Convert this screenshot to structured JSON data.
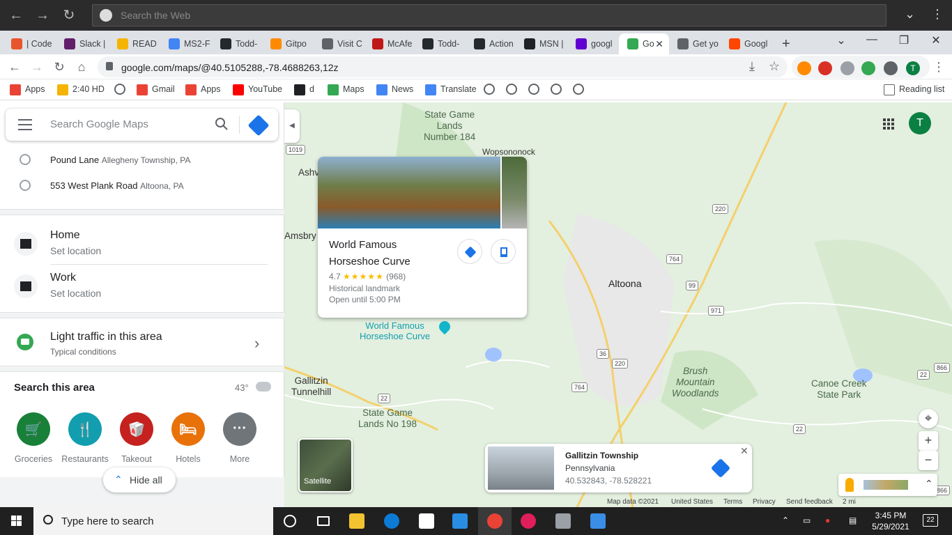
{
  "os_bar": {
    "search_placeholder": "Search the Web"
  },
  "tabs": [
    {
      "label": "| Code",
      "color": "#e8552d"
    },
    {
      "label": "Slack |",
      "color": "#611f69"
    },
    {
      "label": "READ",
      "color": "#f4b400"
    },
    {
      "label": "MS2-F",
      "color": "#4285f4"
    },
    {
      "label": "Todd-",
      "color": "#24292e"
    },
    {
      "label": "Gitpo",
      "color": "#ff8a00"
    },
    {
      "label": "Visit C",
      "color": "#5f6368"
    },
    {
      "label": "McAfe",
      "color": "#c01818"
    },
    {
      "label": "Todd-",
      "color": "#24292e"
    },
    {
      "label": "Action",
      "color": "#24292e"
    },
    {
      "label": "MSN |",
      "color": "#202124"
    },
    {
      "label": "googl",
      "color": "#6001d2"
    },
    {
      "label": "Go",
      "color": "#34a853"
    },
    {
      "label": "Get yo",
      "color": "#5f6368"
    },
    {
      "label": "Googl",
      "color": "#ff4500"
    }
  ],
  "address": {
    "url": "google.com/maps/@40.5105288,-78.4688263,12z"
  },
  "profile_initial": "T",
  "bookmarks": [
    {
      "label": "Apps",
      "color": "#ea4335"
    },
    {
      "label": "2:40 HD",
      "color": "#f4b400"
    },
    {
      "label": "Gmail",
      "color": "#ea4335"
    },
    {
      "label": "Apps",
      "color": "#ea4335"
    },
    {
      "label": "YouTube",
      "color": "#ff0000"
    },
    {
      "label": "d",
      "color": "#202124"
    },
    {
      "label": "Maps",
      "color": "#34a853"
    },
    {
      "label": "News",
      "color": "#4285f4"
    },
    {
      "label": "Translate",
      "color": "#4285f4"
    }
  ],
  "reading_list": "Reading list",
  "panel": {
    "search_placeholder": "Search Google Maps",
    "recent": [
      {
        "title": "Pound Lane",
        "sub": "Allegheny Township, PA"
      },
      {
        "title": "553 West Plank Road",
        "sub": "Altoona, PA"
      }
    ],
    "home": {
      "title": "Home",
      "sub": "Set location"
    },
    "work": {
      "title": "Work",
      "sub": "Set location"
    },
    "traffic": {
      "title": "Light traffic in this area",
      "sub": "Typical conditions"
    },
    "search_area": {
      "title": "Search this area",
      "temp": "43°"
    },
    "categories": [
      {
        "label": "Groceries",
        "color": "#188038",
        "glyph": "🛒"
      },
      {
        "label": "Restaurants",
        "color": "#129eaf",
        "glyph": "🍴"
      },
      {
        "label": "Takeout",
        "color": "#c5221f",
        "glyph": "🥡"
      },
      {
        "label": "Hotels",
        "color": "#e8710a",
        "glyph": "🛏"
      },
      {
        "label": "More",
        "color": "#70757a",
        "glyph": "···"
      }
    ],
    "hide_all": "Hide all"
  },
  "map": {
    "labels": {
      "game_lands_184": "State Game\nLands\nNumber 184",
      "wopsononock": "Wopsononock",
      "ashv": "Ashv",
      "amsbry": "Amsbry",
      "altoona": "Altoona",
      "gallitzin_tunnelhill": "Gallitzin\nTunnelhill",
      "game_lands_198": "State Game\nLands No 198",
      "brush_mountain": "Brush\nMountain\nWoodlands",
      "canoe_creek": "Canoe Creek\nState Park"
    },
    "shields": [
      "1019",
      "220",
      "764",
      "99",
      "971",
      "36",
      "220",
      "764",
      "22",
      "22",
      "22",
      "866",
      "866"
    ],
    "pin_label": "World Famous\nHorseshoe Curve",
    "info_card": {
      "name": "World Famous\nHorseshoe Curve",
      "rating": "4.7",
      "stars": "★★★★★",
      "reviews": "(968)",
      "category": "Historical landmark",
      "hours": "Open until 5:00 PM"
    },
    "satellite_label": "Satellite",
    "location_card": {
      "title": "Gallitzin Township",
      "region": "Pennsylvania",
      "coords": "40.532843, -78.528221"
    },
    "footer": {
      "map_data": "Map data ©2021",
      "country": "United States",
      "terms": "Terms",
      "privacy": "Privacy",
      "feedback": "Send feedback",
      "scale": "2 mi"
    }
  },
  "taskbar": {
    "search": "Type here to search",
    "time": "3:45 PM",
    "date": "5/29/2021",
    "notifications": "22"
  }
}
